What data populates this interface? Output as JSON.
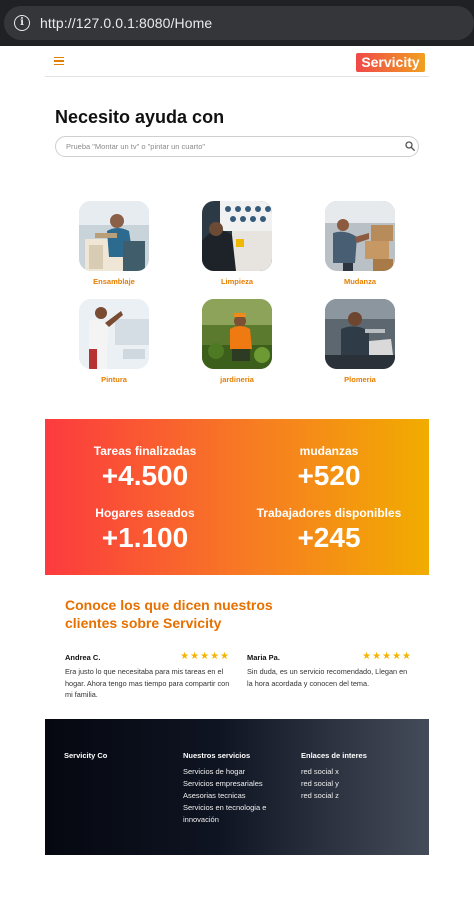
{
  "browser": {
    "url": "http://127.0.0.1:8080/Home"
  },
  "nav": {
    "logo": "Servicity",
    "menu_icon": "hamburger-icon"
  },
  "hero": {
    "title": "Necesito ayuda con",
    "search_placeholder": "Prueba \"Montar un tv\" o \"pintar un cuarto\""
  },
  "categories": [
    {
      "label": "Ensamblaje"
    },
    {
      "label": "Limpieza"
    },
    {
      "label": "Mudanza"
    },
    {
      "label": "Pintura"
    },
    {
      "label": "jardineria"
    },
    {
      "label": "Plomeria"
    }
  ],
  "stats": [
    {
      "label": "Tareas finalizadas",
      "value": "+4.500"
    },
    {
      "label": "mudanzas",
      "value": "+520"
    },
    {
      "label": "Hogares aseados",
      "value": "+1.100"
    },
    {
      "label": "Trabajadores disponibles",
      "value": "+245"
    }
  ],
  "testimonials": {
    "title": "Conoce los que dicen nuestros clientes sobre Servicity",
    "reviews": [
      {
        "name": "Andrea C.",
        "stars": "★★★★★",
        "rating": 5,
        "text": "Era justo lo que necesitaba para mis tareas en el hogar. Ahora tengo mas tiempo para compartir con mi familia."
      },
      {
        "name": "Maria Pa.",
        "stars": "★★★★★",
        "rating": 5,
        "text": "Sin duda, es un servicio recomendado, Llegan en la hora acordada y conocen del tema."
      }
    ]
  },
  "footer": {
    "brand": "Servicity Co",
    "services_heading": "Nuestros servicios",
    "services": [
      "Servicios de hogar",
      "Servicios empresariales",
      "Asesorias tecnicas",
      "Servicios en tecnologia e innovación"
    ],
    "links_heading": "Enlaces de interes",
    "links": [
      "red social x",
      "red social y",
      "red social z"
    ]
  },
  "colors": {
    "accent": "#e67e00",
    "gradient_start": "#fc3a3f",
    "gradient_end": "#f1ac00",
    "footer_dark": "#050810"
  }
}
